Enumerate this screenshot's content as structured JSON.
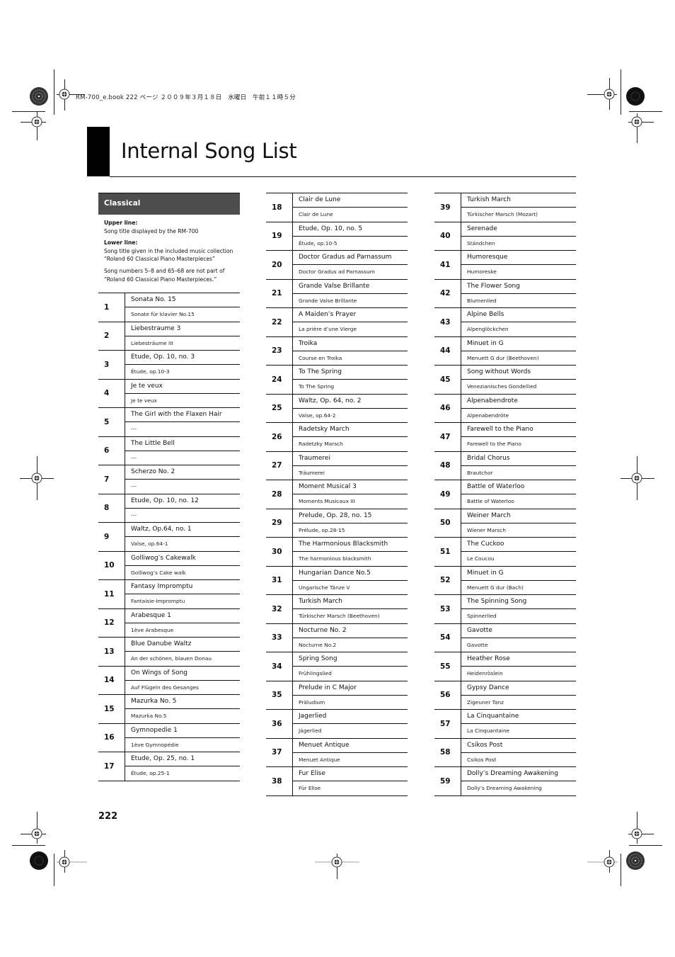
{
  "imprint": "RM-700_e.book  222 ページ  ２００９年３月１８日　水曜日　午前１１時５分",
  "page": {
    "title": "Internal Song List",
    "page_number": "222"
  },
  "category": {
    "label": "Classical",
    "notes": {
      "upper_heading": "Upper line:",
      "upper_text": "Song title displayed by the RM-700",
      "lower_heading": "Lower line:",
      "lower_text_1": "Song title given in the included music collection",
      "lower_text_2": "“Roland 60 Classical Piano Masterpieces”",
      "footnote_1": "Song numbers 5–8 and 65–68 are not part of",
      "footnote_2": "“Roland 60 Classical Piano Masterpieces.”"
    }
  },
  "songs": [
    {
      "no": "1",
      "upper": "Sonata No. 15",
      "lower": "Sonate für klavier No.15"
    },
    {
      "no": "2",
      "upper": "Liebestraume 3",
      "lower": "Liebesträume III"
    },
    {
      "no": "3",
      "upper": "Etude, Op. 10, no. 3",
      "lower": "Étude, op.10-3"
    },
    {
      "no": "4",
      "upper": "Je te veux",
      "lower": "Je te veux"
    },
    {
      "no": "5",
      "upper": "The Girl with the Flaxen Hair",
      "lower": "---"
    },
    {
      "no": "6",
      "upper": "The Little Bell",
      "lower": "---"
    },
    {
      "no": "7",
      "upper": "Scherzo No. 2",
      "lower": "---"
    },
    {
      "no": "8",
      "upper": "Etude, Op. 10, no. 12",
      "lower": "---"
    },
    {
      "no": "9",
      "upper": "Waltz, Op.64, no. 1",
      "lower": "Valse, op.64-1"
    },
    {
      "no": "10",
      "upper": "Golliwog’s Cakewalk",
      "lower": "Golliwog’s Cake walk"
    },
    {
      "no": "11",
      "upper": "Fantasy Impromptu",
      "lower": "Fantaisie-Impromptu"
    },
    {
      "no": "12",
      "upper": "Arabesque 1",
      "lower": "1ève Arabesque"
    },
    {
      "no": "13",
      "upper": "Blue Danube Waltz",
      "lower": "An der schönen, blauen Donau"
    },
    {
      "no": "14",
      "upper": "On Wings of Song",
      "lower": "Auf Flügeln des Gesanges"
    },
    {
      "no": "15",
      "upper": "Mazurka No. 5",
      "lower": "Mazurka No.5"
    },
    {
      "no": "16",
      "upper": "Gymnopedie 1",
      "lower": "1ève Gymnopédie"
    },
    {
      "no": "17",
      "upper": "Etude, Op. 25, no. 1",
      "lower": "Étude, op.25-1"
    },
    {
      "no": "18",
      "upper": "Clair de Lune",
      "lower": "Clair de Lune"
    },
    {
      "no": "19",
      "upper": "Etude, Op. 10, no. 5",
      "lower": "Étude, op.10-5"
    },
    {
      "no": "20",
      "upper": "Doctor Gradus ad Parnassum",
      "lower": "Doctor Gradus ad Parnassum"
    },
    {
      "no": "21",
      "upper": "Grande Valse Brillante",
      "lower": "Grande Valse Brillante"
    },
    {
      "no": "22",
      "upper": "A Maiden’s Prayer",
      "lower": "La prière d’une Vierge"
    },
    {
      "no": "23",
      "upper": "Troika",
      "lower": "Course en Troika"
    },
    {
      "no": "24",
      "upper": "To The Spring",
      "lower": "To The Spring"
    },
    {
      "no": "25",
      "upper": "Waltz, Op. 64, no. 2",
      "lower": "Valse, op.64-2"
    },
    {
      "no": "26",
      "upper": "Radetsky March",
      "lower": "Radetzky Marsch"
    },
    {
      "no": "27",
      "upper": "Traumerei",
      "lower": "Träumerei"
    },
    {
      "no": "28",
      "upper": "Moment Musical 3",
      "lower": "Moments Musicaux III"
    },
    {
      "no": "29",
      "upper": "Prelude, Op. 28, no. 15",
      "lower": "Prélude, op.28-15"
    },
    {
      "no": "30",
      "upper": "The Harmonious Blacksmith",
      "lower": "The harmonious blacksmith"
    },
    {
      "no": "31",
      "upper": "Hungarian Dance No.5",
      "lower": "Ungarische Tänze V"
    },
    {
      "no": "32",
      "upper": "Turkish March",
      "lower": "Türkischer Marsch (Beethoven)"
    },
    {
      "no": "33",
      "upper": "Nocturne No. 2",
      "lower": "Nocturne No.2"
    },
    {
      "no": "34",
      "upper": "Spring Song",
      "lower": "Frühlingslied"
    },
    {
      "no": "35",
      "upper": "Prelude in C Major",
      "lower": "Präludium"
    },
    {
      "no": "36",
      "upper": "Jagerlied",
      "lower": "Jägerlied"
    },
    {
      "no": "37",
      "upper": "Menuet Antique",
      "lower": "Menuet Antique"
    },
    {
      "no": "38",
      "upper": "Fur Elise",
      "lower": "Für Elise"
    },
    {
      "no": "39",
      "upper": "Turkish March",
      "lower": "Türkischer Marsch (Mozart)"
    },
    {
      "no": "40",
      "upper": "Serenade",
      "lower": "Ständchen"
    },
    {
      "no": "41",
      "upper": "Humoresque",
      "lower": "Humoreske"
    },
    {
      "no": "42",
      "upper": "The Flower Song",
      "lower": "Blumenlied"
    },
    {
      "no": "43",
      "upper": "Alpine Bells",
      "lower": "Alpenglöckchen"
    },
    {
      "no": "44",
      "upper": "Minuet in G",
      "lower": "Menuett G dur (Beethoven)"
    },
    {
      "no": "45",
      "upper": "Song without Words",
      "lower": "Venezianisches Gondellied"
    },
    {
      "no": "46",
      "upper": "Alpenabendrote",
      "lower": "Alpenabendröte"
    },
    {
      "no": "47",
      "upper": "Farewell to the Piano",
      "lower": "Farewell to the Piano"
    },
    {
      "no": "48",
      "upper": "Bridal Chorus",
      "lower": "Brautchor"
    },
    {
      "no": "49",
      "upper": "Battle of Waterloo",
      "lower": "Battle of Waterloo"
    },
    {
      "no": "50",
      "upper": "Weiner March",
      "lower": "Wiener Marsch"
    },
    {
      "no": "51",
      "upper": "The Cuckoo",
      "lower": "Le Coucou"
    },
    {
      "no": "52",
      "upper": "Minuet in G",
      "lower": "Menuett G dur (Bach)"
    },
    {
      "no": "53",
      "upper": "The Spinning Song",
      "lower": "Spinnerlied"
    },
    {
      "no": "54",
      "upper": "Gavotte",
      "lower": "Gavotte"
    },
    {
      "no": "55",
      "upper": "Heather Rose",
      "lower": "Heidenröslein"
    },
    {
      "no": "56",
      "upper": "Gypsy Dance",
      "lower": "Zigeuner Tanz"
    },
    {
      "no": "57",
      "upper": "La Cinquantaine",
      "lower": "La Cinquantaine"
    },
    {
      "no": "58",
      "upper": "Csikos Post",
      "lower": "Csikos Post"
    },
    {
      "no": "59",
      "upper": "Dolly’s Dreaming Awakening",
      "lower": "Dolly’s Dreaming Awakening"
    }
  ]
}
